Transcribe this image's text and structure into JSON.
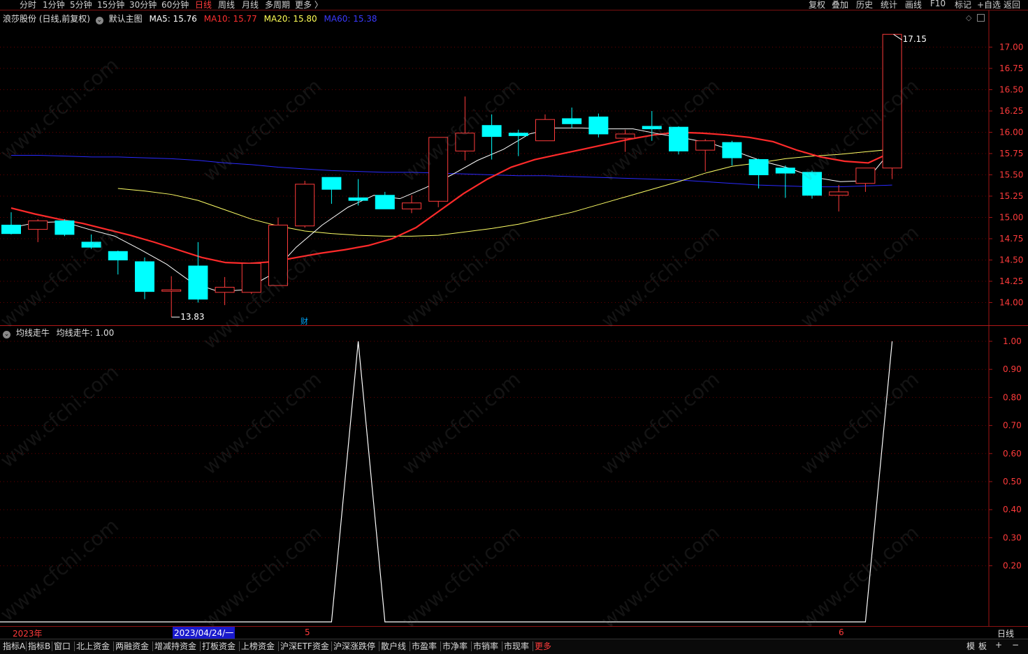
{
  "topbar": {
    "periods": [
      "分时",
      "1分钟",
      "5分钟",
      "15分钟",
      "30分钟",
      "60分钟",
      "日线",
      "周线",
      "月线",
      "多周期",
      "更多 〉"
    ],
    "active_period": "日线",
    "right_buttons": [
      "复权",
      "叠加",
      "历史",
      "统计",
      "画线",
      "F10",
      "标记",
      "+自选",
      "返回"
    ]
  },
  "main_legend": {
    "stock": "浪莎股份 (日线,前复权)",
    "template": "默认主图",
    "ma5": "MA5: 15.76",
    "ma10": "MA10: 15.77",
    "ma20": "MA20: 15.80",
    "ma60": "MA60: 15.38"
  },
  "colors": {
    "up": "#ff3b3b",
    "down": "#00ffff",
    "ma5": "#ffffff",
    "ma10": "#ff2a2a",
    "ma20": "#ffff66",
    "ma60": "#2a2aff",
    "grid": "#6a0000"
  },
  "price_axis_labels": [
    "17.00",
    "16.75",
    "16.50",
    "16.25",
    "16.00",
    "15.75",
    "15.50",
    "15.25",
    "15.00",
    "14.75",
    "14.50",
    "14.25",
    "14.00"
  ],
  "max_label": "17.15",
  "min_label": "13.83",
  "cai_marker": "财",
  "sub_legend": {
    "name": "均线走牛",
    "value": "均线走牛: 1.00"
  },
  "sub_axis_labels": [
    "1.00",
    "0.90",
    "0.80",
    "0.70",
    "0.60",
    "0.50",
    "0.40",
    "0.30",
    "0.20"
  ],
  "time_axis": {
    "year": "2023年",
    "cursor_date": "2023/04/24/一",
    "m5": "5",
    "m6": "6",
    "period": "日线"
  },
  "bottom_tabs": [
    "指标A",
    "指标B",
    "窗口",
    "北上资金",
    "两融资金",
    "增减持资金",
    "打板资金",
    "上榜资金",
    "沪深ETF资金",
    "沪深涨跌停",
    "散户线",
    "市盈率",
    "市净率",
    "市销率",
    "市现率",
    "更多"
  ],
  "bottom_right": [
    "模",
    "板",
    "+",
    "−"
  ],
  "chart_data": {
    "type": "candlestick",
    "y_axis": {
      "min": 13.75,
      "max": 17.25
    },
    "candles": [
      {
        "o": 14.91,
        "h": 15.06,
        "l": 14.8,
        "c": 14.81
      },
      {
        "o": 14.86,
        "h": 14.98,
        "l": 14.71,
        "c": 14.96
      },
      {
        "o": 14.96,
        "h": 14.98,
        "l": 14.78,
        "c": 14.8
      },
      {
        "o": 14.71,
        "h": 14.8,
        "l": 14.63,
        "c": 14.65
      },
      {
        "o": 14.6,
        "h": 14.61,
        "l": 14.33,
        "c": 14.5
      },
      {
        "o": 14.48,
        "h": 14.53,
        "l": 14.04,
        "c": 14.13
      },
      {
        "o": 14.14,
        "h": 14.31,
        "l": 13.83,
        "c": 14.15
      },
      {
        "o": 14.43,
        "h": 14.71,
        "l": 14.0,
        "c": 14.04
      },
      {
        "o": 14.12,
        "h": 14.3,
        "l": 13.97,
        "c": 14.18
      },
      {
        "o": 14.12,
        "h": 14.47,
        "l": 14.1,
        "c": 14.46
      },
      {
        "o": 14.2,
        "h": 15.0,
        "l": 14.2,
        "c": 14.91
      },
      {
        "o": 14.9,
        "h": 15.43,
        "l": 14.88,
        "c": 15.39
      },
      {
        "o": 15.47,
        "h": 15.47,
        "l": 15.16,
        "c": 15.33
      },
      {
        "o": 15.23,
        "h": 15.45,
        "l": 15.14,
        "c": 15.2
      },
      {
        "o": 15.26,
        "h": 15.3,
        "l": 15.1,
        "c": 15.1
      },
      {
        "o": 15.1,
        "h": 15.26,
        "l": 15.05,
        "c": 15.17
      },
      {
        "o": 15.19,
        "h": 15.94,
        "l": 15.12,
        "c": 15.94
      },
      {
        "o": 15.78,
        "h": 16.42,
        "l": 15.67,
        "c": 15.99
      },
      {
        "o": 16.08,
        "h": 16.21,
        "l": 15.68,
        "c": 15.95
      },
      {
        "o": 15.99,
        "h": 16.03,
        "l": 15.72,
        "c": 15.96
      },
      {
        "o": 15.9,
        "h": 16.21,
        "l": 15.9,
        "c": 16.15
      },
      {
        "o": 16.16,
        "h": 16.29,
        "l": 16.05,
        "c": 16.1
      },
      {
        "o": 16.18,
        "h": 16.22,
        "l": 15.94,
        "c": 15.98
      },
      {
        "o": 15.93,
        "h": 16.03,
        "l": 15.77,
        "c": 15.98
      },
      {
        "o": 16.07,
        "h": 16.25,
        "l": 15.9,
        "c": 16.04
      },
      {
        "o": 16.06,
        "h": 16.07,
        "l": 15.74,
        "c": 15.78
      },
      {
        "o": 15.79,
        "h": 15.92,
        "l": 15.54,
        "c": 15.9
      },
      {
        "o": 15.88,
        "h": 15.9,
        "l": 15.61,
        "c": 15.7
      },
      {
        "o": 15.68,
        "h": 15.69,
        "l": 15.34,
        "c": 15.5
      },
      {
        "o": 15.58,
        "h": 15.61,
        "l": 15.23,
        "c": 15.52
      },
      {
        "o": 15.53,
        "h": 15.55,
        "l": 15.22,
        "c": 15.26
      },
      {
        "o": 15.26,
        "h": 15.38,
        "l": 15.07,
        "c": 15.3
      },
      {
        "o": 15.4,
        "h": 15.56,
        "l": 15.3,
        "c": 15.58
      },
      {
        "o": 15.58,
        "h": 17.15,
        "l": 15.45,
        "c": 17.15
      }
    ],
    "ma5": [
      14.88,
      14.94,
      14.95,
      14.86,
      14.78,
      14.62,
      14.45,
      14.23,
      14.13,
      14.15,
      14.32,
      14.65,
      14.91,
      15.12,
      15.26,
      15.22,
      15.35,
      15.5,
      15.67,
      15.8,
      15.98,
      16.05,
      16.05,
      16.04,
      16.04,
      15.98,
      15.93,
      15.87,
      15.77,
      15.66,
      15.58,
      15.47,
      15.42,
      15.43,
      15.8
    ],
    "ma10": [
      15.11,
      15.04,
      14.98,
      14.93,
      14.86,
      14.79,
      14.71,
      14.62,
      14.53,
      14.47,
      14.46,
      14.48,
      14.53,
      14.58,
      14.62,
      14.67,
      14.75,
      14.88,
      15.08,
      15.28,
      15.45,
      15.59,
      15.68,
      15.74,
      15.8,
      15.86,
      15.92,
      15.97,
      16.0,
      15.99,
      15.97,
      15.94,
      15.89,
      15.79,
      15.71,
      15.66,
      15.64,
      15.77
    ],
    "ma20": [
      15.34,
      15.31,
      15.27,
      15.2,
      15.09,
      14.98,
      14.9,
      14.84,
      14.81,
      14.79,
      14.78,
      14.78,
      14.79,
      14.83,
      14.87,
      14.92,
      14.99,
      15.06,
      15.15,
      15.24,
      15.33,
      15.42,
      15.52,
      15.6,
      15.64,
      15.69,
      15.72,
      15.74,
      15.77,
      15.8
    ],
    "ma60": [
      15.73,
      15.73,
      15.72,
      15.71,
      15.71,
      15.7,
      15.69,
      15.67,
      15.64,
      15.62,
      15.59,
      15.57,
      15.55,
      15.54,
      15.53,
      15.53,
      15.52,
      15.51,
      15.5,
      15.49,
      15.49,
      15.48,
      15.47,
      15.46,
      15.45,
      15.44,
      15.42,
      15.4,
      15.38,
      15.37,
      15.36,
      15.36,
      15.37,
      15.38
    ],
    "signal": {
      "x_labels": "same as candles",
      "values": [
        0,
        0,
        0,
        0,
        0,
        0,
        0,
        0,
        0,
        0,
        0,
        0,
        0,
        1,
        0,
        0,
        0,
        0,
        0,
        0,
        0,
        0,
        0,
        0,
        0,
        0,
        0,
        0,
        0,
        0,
        0,
        0,
        0,
        1
      ]
    }
  }
}
